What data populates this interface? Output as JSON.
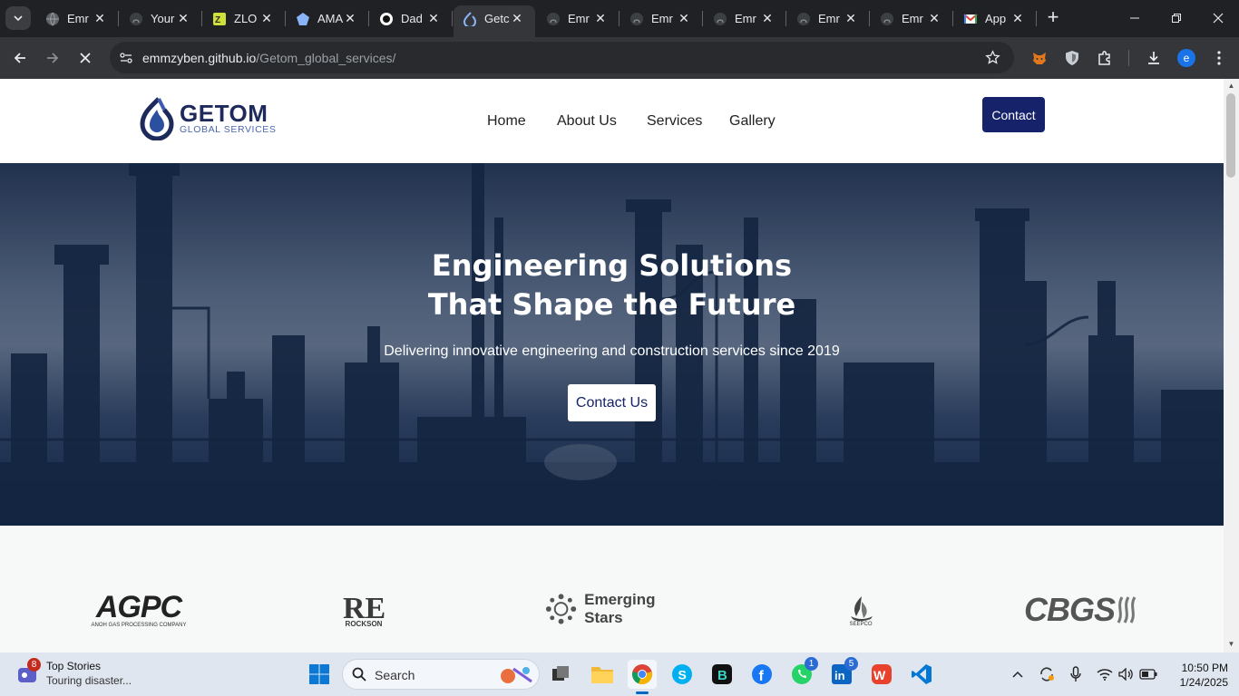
{
  "browser": {
    "tabs": [
      {
        "title": "Emr",
        "icon": "github-globe-icon"
      },
      {
        "title": "Your",
        "icon": "github-icon"
      },
      {
        "title": "ZLO",
        "icon": "zlo-icon"
      },
      {
        "title": "AMA",
        "icon": "ama-icon"
      },
      {
        "title": "Dad",
        "icon": "dad-icon"
      },
      {
        "title": "Getc",
        "icon": "getom-icon",
        "active": true
      },
      {
        "title": "Emr",
        "icon": "github-icon"
      },
      {
        "title": "Emr",
        "icon": "github-icon"
      },
      {
        "title": "Emr",
        "icon": "github-icon"
      },
      {
        "title": "Emr",
        "icon": "github-icon"
      },
      {
        "title": "Emr",
        "icon": "github-icon"
      },
      {
        "title": "App",
        "icon": "gmail-icon"
      }
    ],
    "url_host": "emmzyben.github.io",
    "url_path": "/Getom_global_services/",
    "profile_initial": "e"
  },
  "site": {
    "logo_name": "GETOM",
    "logo_sub": "GLOBAL SERVICES",
    "nav": {
      "home": "Home",
      "about": "About Us",
      "services": "Services",
      "gallery": "Gallery"
    },
    "contact_button": "Contact",
    "hero": {
      "title_line1": "Engineering Solutions",
      "title_line2": "That Shape the Future",
      "subtitle": "Delivering innovative engineering and construction services since 2019",
      "cta": "Contact Us"
    },
    "partners": {
      "agpc": "AGPC",
      "agpc_sub": "ANOH GAS PROCESSING COMPANY",
      "rockson": "ROCKSON",
      "emerging": "Emerging Stars",
      "seepco": "SEEPCO",
      "cbgs": "CBGS"
    }
  },
  "taskbar": {
    "news_title": "Top Stories",
    "news_sub": "Touring disaster...",
    "news_badge": "8",
    "search_placeholder": "Search",
    "whatsapp_badge": "1",
    "linkedin_badge": "5",
    "time": "10:50 PM",
    "date": "1/24/2025"
  }
}
